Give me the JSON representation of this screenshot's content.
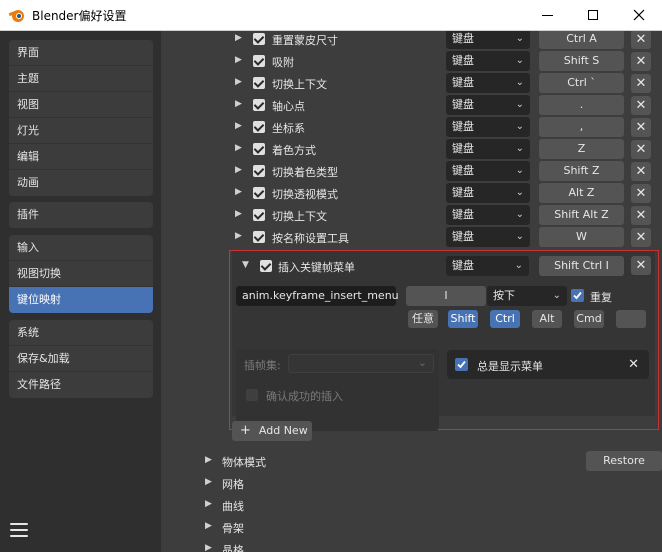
{
  "window": {
    "title": "Blender偏好设置"
  },
  "sidebar": {
    "groups": [
      [
        "界面",
        "主题",
        "视图",
        "灯光",
        "编辑",
        "动画"
      ],
      [
        "插件"
      ],
      [
        "输入",
        "视图切换",
        "键位映射"
      ],
      [
        "系统",
        "保存&加载",
        "文件路径"
      ]
    ],
    "active": "键位映射"
  },
  "keymap_rows": [
    {
      "name": "重置蒙皮尺寸",
      "device": "键盘",
      "key": "Ctrl A"
    },
    {
      "name": "吸附",
      "device": "键盘",
      "key": "Shift S"
    },
    {
      "name": "切换上下文",
      "device": "键盘",
      "key": "Ctrl `"
    },
    {
      "name": "轴心点",
      "device": "键盘",
      "key": "."
    },
    {
      "name": "坐标系",
      "device": "键盘",
      "key": ","
    },
    {
      "name": "着色方式",
      "device": "键盘",
      "key": "Z"
    },
    {
      "name": "切换着色类型",
      "device": "键盘",
      "key": "Shift Z"
    },
    {
      "name": "切换透视模式",
      "device": "键盘",
      "key": "Alt Z"
    },
    {
      "name": "切换上下文",
      "device": "键盘",
      "key": "Shift Alt Z"
    },
    {
      "name": "按名称设置工具",
      "device": "键盘",
      "key": "W"
    }
  ],
  "expanded": {
    "name": "插入关键帧菜单",
    "device": "键盘",
    "key": "Shift Ctrl I",
    "operator": "anim.keyframe_insert_menu",
    "key_field": "I",
    "event": "按下",
    "repeat_label": "重复",
    "modifiers": [
      {
        "label": "任意",
        "active": false
      },
      {
        "label": "Shift",
        "active": true
      },
      {
        "label": "Ctrl",
        "active": true
      },
      {
        "label": "Alt",
        "active": false
      },
      {
        "label": "Cmd",
        "active": false
      },
      {
        "label": "",
        "active": false
      }
    ],
    "keying_set_label": "插帧集:",
    "always_show_menu": "总是显示菜单",
    "confirm_success": "确认成功的插入"
  },
  "add_new_label": "Add New",
  "restore_label": "Restore",
  "sections": [
    "物体模式",
    "网格",
    "曲线",
    "骨架",
    "晶格"
  ],
  "colors": {
    "accent": "#4772b3",
    "highlight_border": "#c83232"
  }
}
